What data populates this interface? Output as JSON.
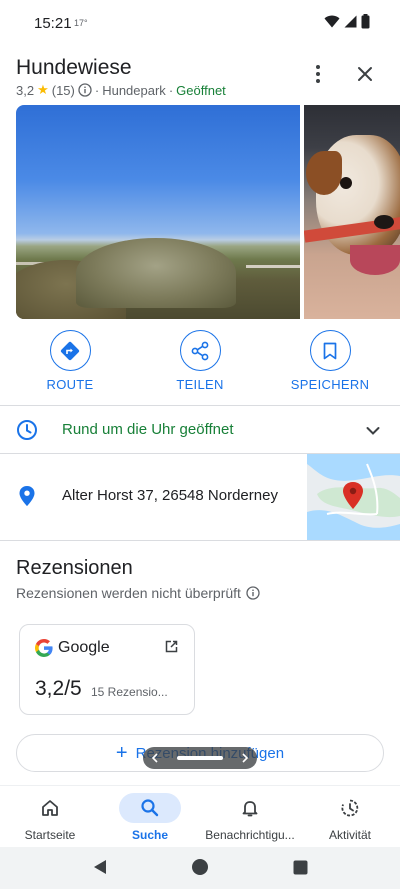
{
  "status_bar": {
    "time": "15:21",
    "temperature": "17°"
  },
  "place": {
    "name": "Hundewiese",
    "rating": "3,2",
    "review_count": "(15)",
    "category": "Hundepark",
    "open_status": "Geöffnet",
    "separator": "·"
  },
  "actions": [
    {
      "label": "ROUTE",
      "icon": "directions-icon"
    },
    {
      "label": "TEILEN",
      "icon": "share-icon"
    },
    {
      "label": "SPEICHERN",
      "icon": "bookmark-icon"
    }
  ],
  "hours": {
    "text": "Rund um die Uhr geöffnet"
  },
  "address": {
    "text": "Alter Horst 37, 26548 Norderney"
  },
  "reviews": {
    "title": "Rezensionen",
    "note": "Rezensionen werden nicht überprüft",
    "google_card": {
      "source": "Google",
      "score": "3,2/5",
      "count": "15 Rezensio..."
    },
    "add_button": "Rezension hinzufügen"
  },
  "bottom_nav": [
    {
      "label": "Startseite",
      "icon": "home-icon",
      "active": false
    },
    {
      "label": "Suche",
      "icon": "search-icon",
      "active": true
    },
    {
      "label": "Benachrichtigu...",
      "icon": "bell-icon",
      "active": false
    },
    {
      "label": "Aktivität",
      "icon": "activity-icon",
      "active": false
    }
  ],
  "colors": {
    "accent": "#1a73e8",
    "open_green": "#188038",
    "star": "#fbbc04",
    "map_pin": "#d93025"
  }
}
